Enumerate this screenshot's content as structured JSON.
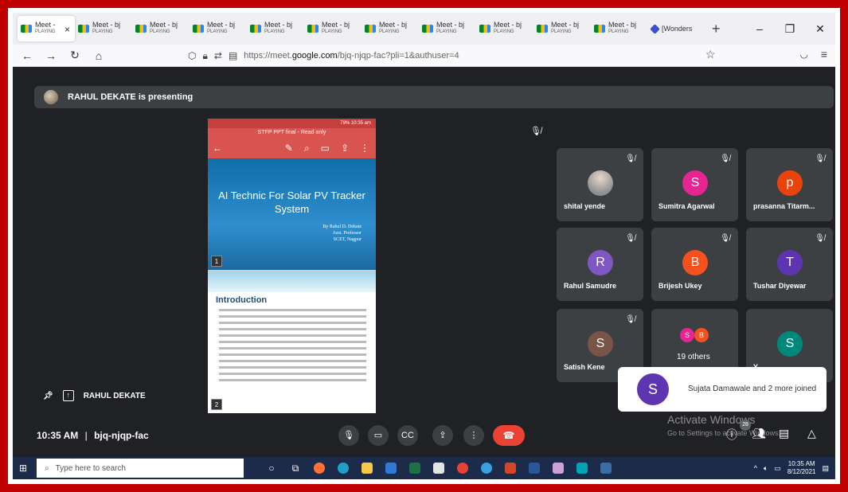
{
  "browser": {
    "tabs": [
      {
        "title": "Meet -",
        "sub": "PLAYING",
        "active": true
      },
      {
        "title": "Meet - bj",
        "sub": "PLAYING"
      },
      {
        "title": "Meet - bj",
        "sub": "PLAYING"
      },
      {
        "title": "Meet - bj",
        "sub": "PLAYING"
      },
      {
        "title": "Meet - bj",
        "sub": "PLAYING"
      },
      {
        "title": "Meet - bj",
        "sub": "PLAYING"
      },
      {
        "title": "Meet - bj",
        "sub": "PLAYING"
      },
      {
        "title": "Meet - bj",
        "sub": "PLAYING"
      },
      {
        "title": "Meet - bj",
        "sub": "PLAYING"
      },
      {
        "title": "Meet - bj",
        "sub": "PLAYING"
      },
      {
        "title": "Meet - bj",
        "sub": "PLAYING"
      }
    ],
    "last_tab": "[Wonders",
    "url_prefix": "https://meet.",
    "url_domain": "google.com",
    "url_path": "/bjq-njqp-fac?pli=1&authuser=4"
  },
  "meet": {
    "presenting_label": "RAHUL DEKATE is presenting",
    "slide": {
      "status": "79% 10:35 am",
      "app_title": "STFP PPT final - Read only",
      "page1_title": "AI Technic For Solar PV Tracker System",
      "author_lines": [
        "By Rahul D. Dekate",
        "Asst. Professor",
        "SCET, Nagpur"
      ],
      "page1_num": "1",
      "page2_title": "Introduction",
      "page2_num": "2"
    },
    "participants": [
      {
        "name": "shital yende",
        "initial": "",
        "color": "",
        "photo": true
      },
      {
        "name": "Sumitra Agarwal",
        "initial": "S",
        "color": "#e52592"
      },
      {
        "name": "prasanna Titarm...",
        "initial": "p",
        "color": "#e8430a"
      },
      {
        "name": "Rahul Samudre",
        "initial": "R",
        "color": "#7e57c2"
      },
      {
        "name": "Brijesh Ukey",
        "initial": "B",
        "color": "#f4511e"
      },
      {
        "name": "Tushar Diyewar",
        "initial": "T",
        "color": "#5e35b1"
      },
      {
        "name": "Satish Kene",
        "initial": "S",
        "color": "#795548"
      },
      {
        "name": "19 others",
        "initial": "S",
        "initial2": "B",
        "color": "#e52592",
        "color2": "#f4511e"
      },
      {
        "name": "Y",
        "initial": "S",
        "color": "#00897b"
      }
    ],
    "toast": {
      "initial": "S",
      "text": "Sujata Damawale and 2 more joined"
    },
    "pinned_name": "RAHUL DEKATE",
    "time": "10:35 AM",
    "separator": "|",
    "meeting_code": "bjq-njqp-fac",
    "people_count": "28",
    "activate_title": "Activate Windows",
    "activate_sub": "Go to Settings to activate Windows."
  },
  "taskbar": {
    "search_placeholder": "Type here to search",
    "time": "10:35 AM",
    "date": "8/12/2021"
  },
  "colors": {
    "frame": "#c00000",
    "meet_bg": "#202124",
    "tile": "#3c4043",
    "end_call": "#ea4335"
  }
}
